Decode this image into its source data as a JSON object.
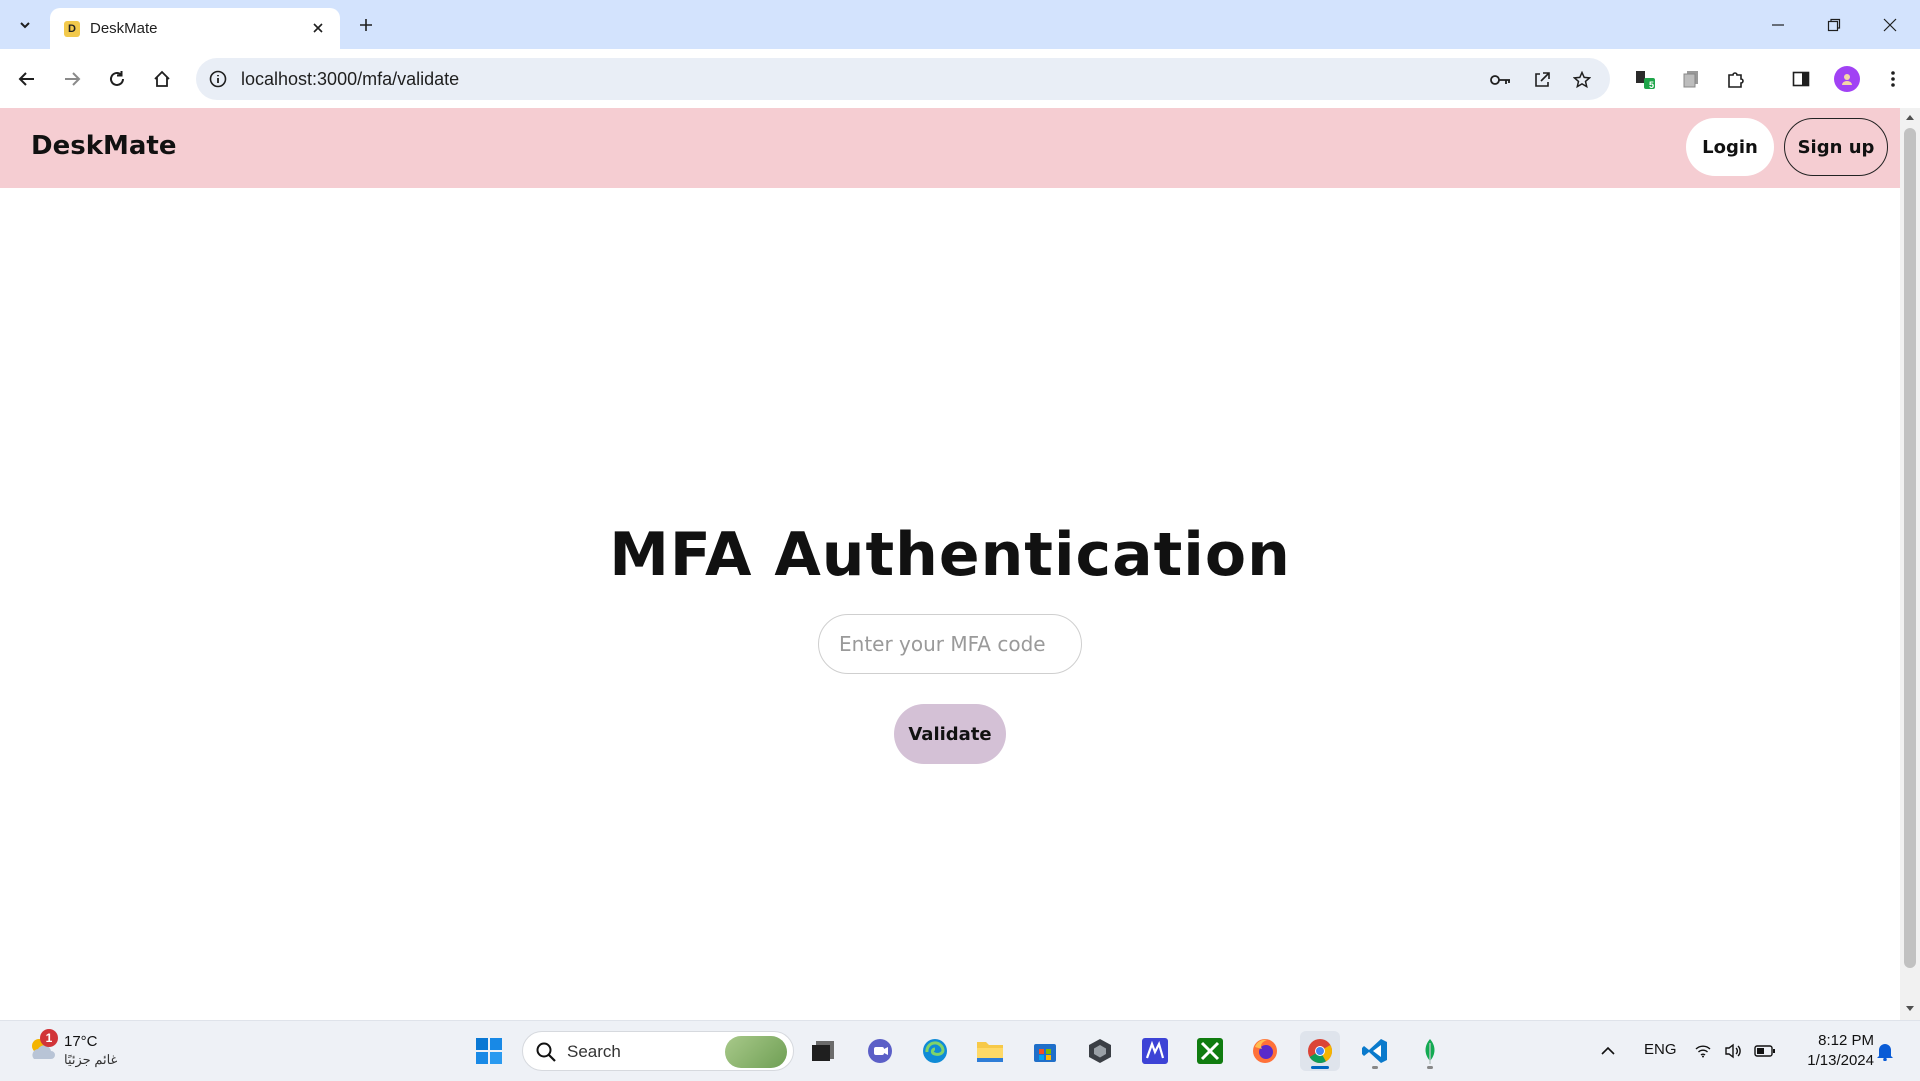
{
  "browser": {
    "tab_title": "DeskMate",
    "favicon_letter": "D",
    "url": "localhost:3000/mfa/validate"
  },
  "page": {
    "brand": "DeskMate",
    "login_label": "Login",
    "signup_label": "Sign up",
    "heading": "MFA Authentication",
    "mfa_placeholder": "Enter your MFA code",
    "validate_label": "Validate",
    "nav_color": "#f5cdd2",
    "validate_color": "#d4c1d6"
  },
  "taskbar": {
    "weather_badge": "1",
    "temperature": "17°C",
    "condition": "غائم جزئيًا",
    "search_label": "Search",
    "language": "ENG",
    "time": "8:12 PM",
    "date": "1/13/2024"
  },
  "extensions": {
    "badge_count": "5"
  }
}
